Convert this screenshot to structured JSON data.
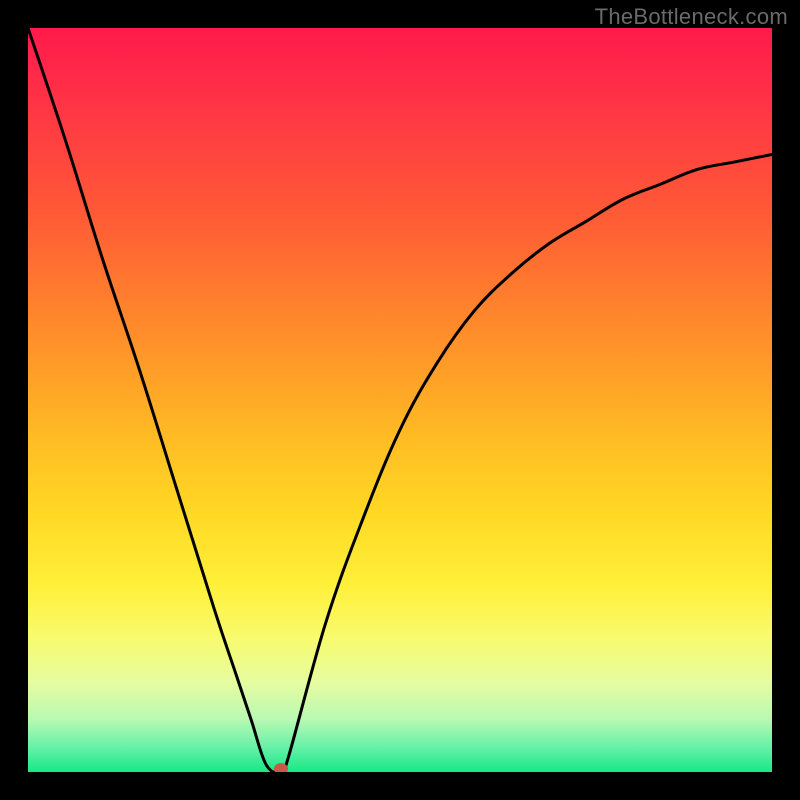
{
  "watermark": "TheBottleneck.com",
  "chart_data": {
    "type": "line",
    "title": "",
    "xlabel": "",
    "ylabel": "",
    "xlim": [
      0,
      100
    ],
    "ylim": [
      0,
      100
    ],
    "x": [
      0,
      5,
      10,
      15,
      20,
      25,
      28,
      30,
      32,
      34,
      35,
      40,
      45,
      50,
      55,
      60,
      65,
      70,
      75,
      80,
      85,
      90,
      95,
      100
    ],
    "values": [
      100,
      85,
      69,
      54,
      38,
      22,
      13,
      7,
      1,
      0,
      2,
      20,
      34,
      46,
      55,
      62,
      67,
      71,
      74,
      77,
      79,
      81,
      82,
      83
    ],
    "minimum_point": {
      "x": 34,
      "y": 0
    },
    "marker": {
      "x": 34,
      "y": 0,
      "color": "#c85a4a"
    },
    "gradient_bands": [
      {
        "pos": 0.0,
        "color": "#ff1a4b"
      },
      {
        "pos": 0.07,
        "color": "#ff2b48"
      },
      {
        "pos": 0.15,
        "color": "#ff4040"
      },
      {
        "pos": 0.25,
        "color": "#ff5a36"
      },
      {
        "pos": 0.35,
        "color": "#ff7a2e"
      },
      {
        "pos": 0.45,
        "color": "#ff9a28"
      },
      {
        "pos": 0.55,
        "color": "#ffbb24"
      },
      {
        "pos": 0.65,
        "color": "#ffd823"
      },
      {
        "pos": 0.75,
        "color": "#fff03a"
      },
      {
        "pos": 0.82,
        "color": "#f8fb6e"
      },
      {
        "pos": 0.88,
        "color": "#e6fca0"
      },
      {
        "pos": 0.93,
        "color": "#b8f9b2"
      },
      {
        "pos": 0.97,
        "color": "#5ef0a6"
      },
      {
        "pos": 1.0,
        "color": "#17e884"
      }
    ]
  }
}
